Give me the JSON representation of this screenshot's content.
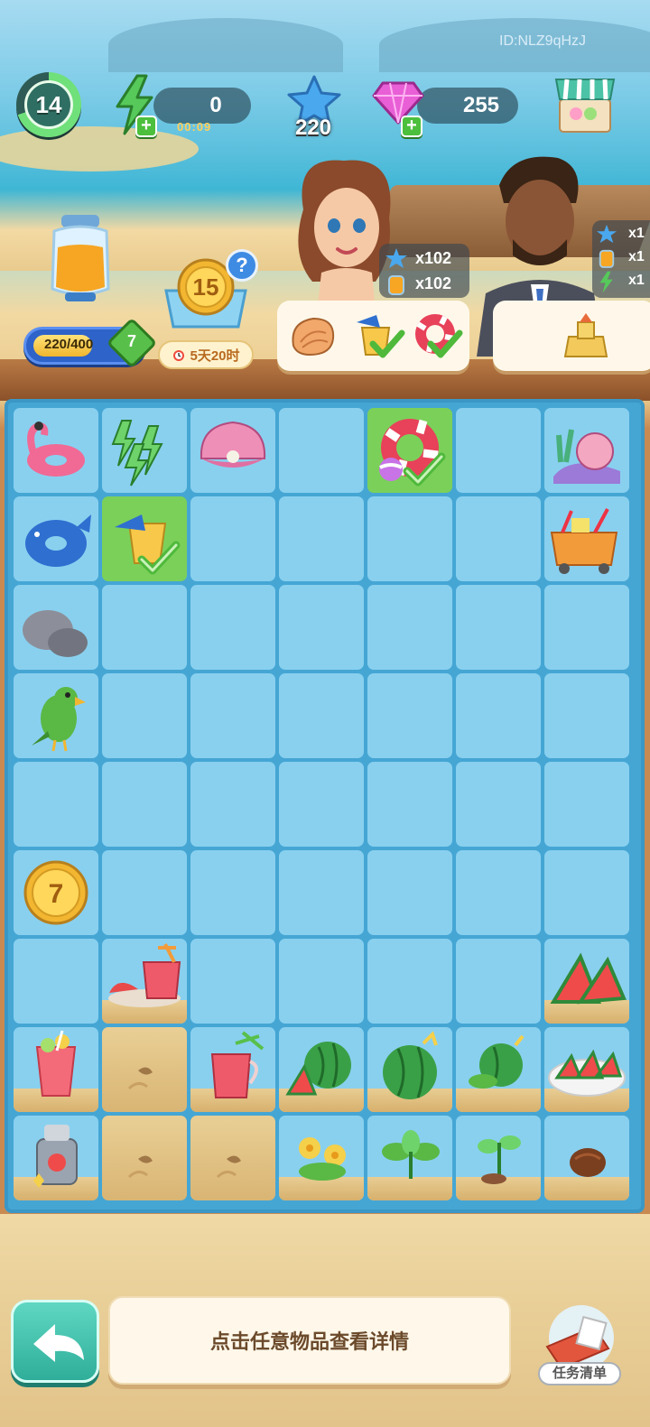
{
  "hud": {
    "level": "14",
    "energy": "0",
    "energy_timer": "00:09",
    "stars": "220",
    "gems": "255",
    "player_id": "ID:NLZ9qHzJ"
  },
  "jar": {
    "progress_text": "220/400",
    "progress_value": 0.55,
    "gem_level": "7"
  },
  "coin_bank": {
    "coin_value": "15",
    "help": "?",
    "timer": "5天20时"
  },
  "characters": [
    {
      "name": "girl",
      "reward_stars": "x102",
      "reward_jar": "x102"
    },
    {
      "name": "man",
      "reward_stars": "x1",
      "reward_jar": "x1",
      "reward_energy": "x1"
    }
  ],
  "orders": [
    {
      "items": [
        "conch-shell",
        "sand-bucket",
        "swim-ring"
      ],
      "checked": [
        false,
        true,
        true
      ]
    },
    {
      "items": [
        "sand-castle"
      ],
      "checked": [
        false
      ]
    }
  ],
  "board": {
    "cols": 7,
    "rows": 9,
    "items": [
      {
        "r": 0,
        "c": 0,
        "item": "flamingo-float"
      },
      {
        "r": 0,
        "c": 1,
        "item": "energy-bolts"
      },
      {
        "r": 0,
        "c": 2,
        "item": "pearl-shell"
      },
      {
        "r": 0,
        "c": 4,
        "item": "swim-ring",
        "selected": true,
        "checked": true
      },
      {
        "r": 0,
        "c": 6,
        "item": "coral-shell-pile"
      },
      {
        "r": 1,
        "c": 0,
        "item": "whale-float"
      },
      {
        "r": 1,
        "c": 1,
        "item": "sand-bucket",
        "selected": true,
        "checked": true
      },
      {
        "r": 1,
        "c": 6,
        "item": "beach-cart"
      },
      {
        "r": 2,
        "c": 0,
        "item": "rocks"
      },
      {
        "r": 3,
        "c": 0,
        "item": "parrot"
      },
      {
        "r": 5,
        "c": 0,
        "item": "coin-7"
      },
      {
        "r": 6,
        "c": 1,
        "item": "punch-tray",
        "sand": true
      },
      {
        "r": 6,
        "c": 6,
        "item": "watermelon-slices",
        "sand": true
      },
      {
        "r": 7,
        "c": 0,
        "item": "fruit-drink",
        "sand": true
      },
      {
        "r": 7,
        "c": 1,
        "item": "sand-patch",
        "sand": true
      },
      {
        "r": 7,
        "c": 2,
        "item": "punch-pitcher",
        "sand": true
      },
      {
        "r": 7,
        "c": 3,
        "item": "cut-watermelon",
        "sand": true
      },
      {
        "r": 7,
        "c": 4,
        "item": "watermelon",
        "sand": true
      },
      {
        "r": 7,
        "c": 5,
        "item": "watermelon-plant",
        "sand": true
      },
      {
        "r": 7,
        "c": 6,
        "item": "watermelon-plate",
        "sand": true
      },
      {
        "r": 8,
        "c": 0,
        "item": "juicer",
        "sand": true
      },
      {
        "r": 8,
        "c": 1,
        "item": "sand-patch",
        "sand": true
      },
      {
        "r": 8,
        "c": 2,
        "item": "sand-patch",
        "sand": true
      },
      {
        "r": 8,
        "c": 3,
        "item": "flowering-plant",
        "sand": true
      },
      {
        "r": 8,
        "c": 4,
        "item": "leafy-plant",
        "sand": true
      },
      {
        "r": 8,
        "c": 5,
        "item": "sprout",
        "sand": true
      },
      {
        "r": 8,
        "c": 6,
        "item": "seed",
        "sand": true
      }
    ]
  },
  "bottom": {
    "hint": "点击任意物品查看详情",
    "task_list": "任务清单"
  },
  "colors": {
    "cell": "#89d0ef",
    "selected_cell": "#7bd05a",
    "board_border": "#3b97c5"
  }
}
